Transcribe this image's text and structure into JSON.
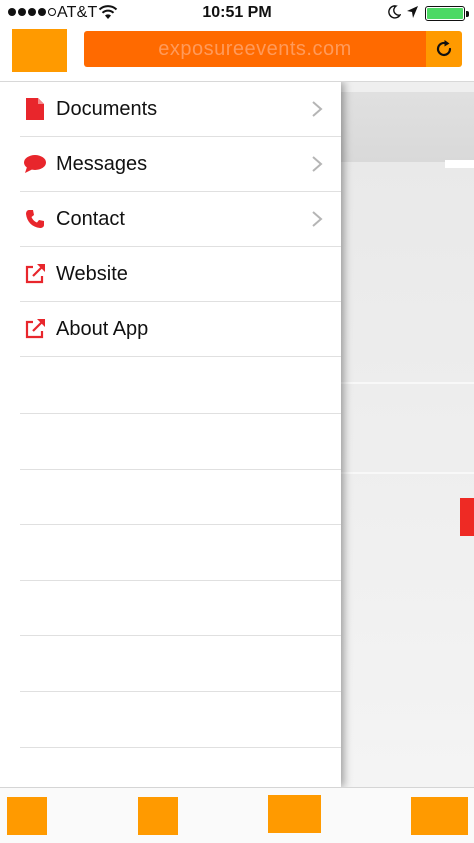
{
  "status_bar": {
    "carrier": "AT&T",
    "time": "10:51 PM",
    "signal_bars_filled": 4,
    "signal_bars_total": 5,
    "battery_level": 1.0
  },
  "header": {
    "address_text": "exposureevents.com",
    "menu_icon": "menu-button",
    "reload_icon": "reload-icon"
  },
  "drawer": {
    "items": [
      {
        "label": "Documents",
        "icon": "document-icon",
        "has_chevron": true
      },
      {
        "label": "Messages",
        "icon": "speech-bubble-icon",
        "has_chevron": true
      },
      {
        "label": "Contact",
        "icon": "phone-icon",
        "has_chevron": true
      },
      {
        "label": "Website",
        "icon": "external-link-icon",
        "has_chevron": false
      },
      {
        "label": "About App",
        "icon": "external-link-icon",
        "has_chevron": false
      }
    ]
  },
  "bottom_toolbar": {
    "buttons": [
      "back-button",
      "forward-button",
      "share-button",
      "action-button"
    ]
  },
  "colors": {
    "accent_orange": "#ff9a00",
    "address_orange": "#ff6a00",
    "icon_red": "#e8262c",
    "battery_green": "#4cd964"
  }
}
